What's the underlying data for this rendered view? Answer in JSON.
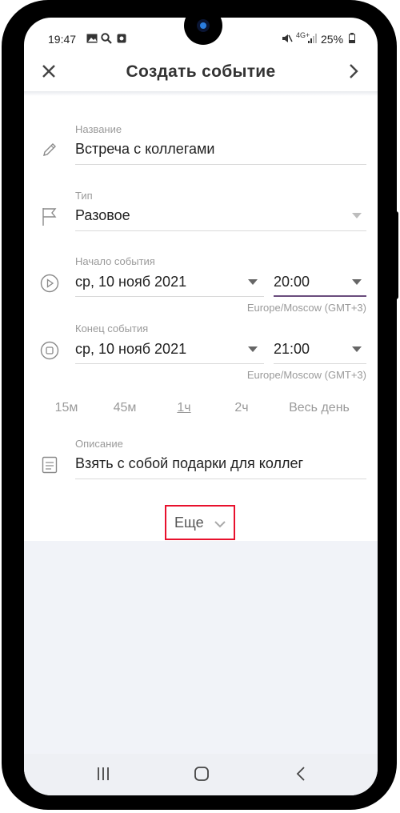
{
  "status_bar": {
    "time": "19:47",
    "left_icons": [
      "image-icon",
      "search-icon",
      "record-icon"
    ],
    "network": "4G+",
    "battery": "25%"
  },
  "header": {
    "title": "Создать событие",
    "close_icon": "close-icon",
    "next_icon": "chevron-right-icon"
  },
  "form": {
    "name": {
      "label": "Название",
      "value": "Встреча с коллегами",
      "icon": "pencil-icon"
    },
    "type": {
      "label": "Тип",
      "value": "Разовое",
      "icon": "flag-icon"
    },
    "start": {
      "label": "Начало события",
      "date": "ср, 10 нояб 2021",
      "time": "20:00",
      "timezone": "Europe/Moscow (GMT+3)",
      "icon": "play-circle-icon"
    },
    "end": {
      "label": "Конец события",
      "date": "ср, 10 нояб 2021",
      "time": "21:00",
      "timezone": "Europe/Moscow (GMT+3)",
      "icon": "stop-circle-icon"
    },
    "durations": [
      {
        "label": "15м",
        "selected": false
      },
      {
        "label": "45м",
        "selected": false
      },
      {
        "label": "1ч",
        "selected": true
      },
      {
        "label": "2ч",
        "selected": false
      },
      {
        "label": "Весь день",
        "selected": false
      }
    ],
    "description": {
      "label": "Описание",
      "value": "Взять с собой подарки для коллег",
      "icon": "document-icon"
    }
  },
  "more": {
    "label": "Еще",
    "highlight_color": "#e8112d"
  },
  "nav_bar": {
    "recents": "recents-icon",
    "home": "home-icon",
    "back": "back-icon"
  },
  "colors": {
    "active_underline": "#6a4c7d",
    "background_lower": "#f1f3f8"
  }
}
